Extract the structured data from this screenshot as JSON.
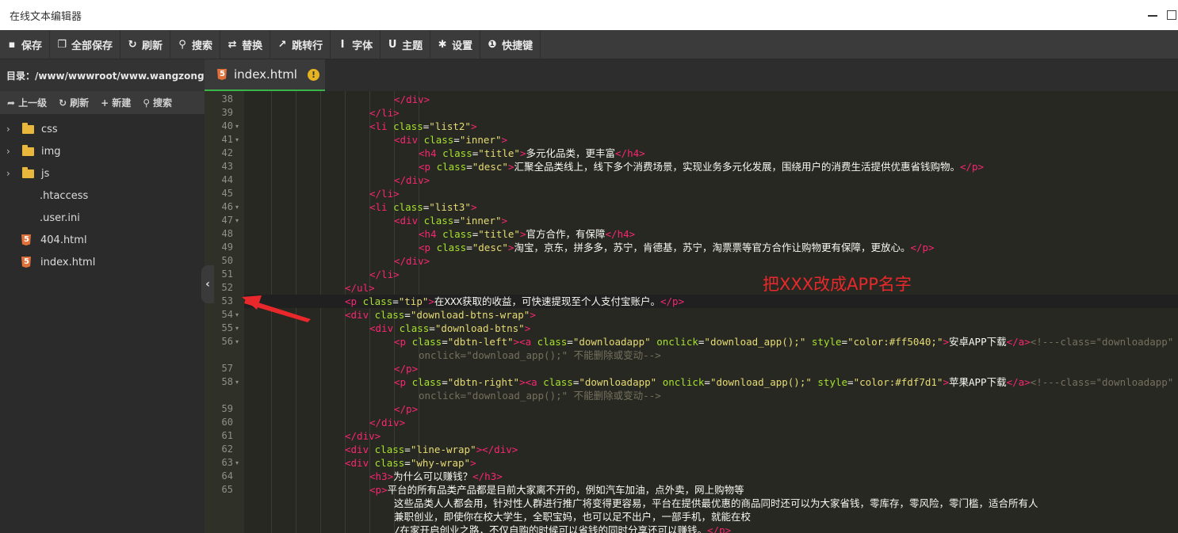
{
  "window": {
    "title": "在线文本编辑器"
  },
  "toolbar": [
    {
      "label": "保存",
      "icon": "save-icon"
    },
    {
      "label": "全部保存",
      "icon": "save-all-icon"
    },
    {
      "label": "刷新",
      "icon": "refresh-icon"
    },
    {
      "label": "搜索",
      "icon": "search-icon"
    },
    {
      "label": "替换",
      "icon": "replace-icon"
    },
    {
      "label": "跳转行",
      "icon": "goto-line-icon"
    },
    {
      "label": "字体",
      "icon": "font-icon"
    },
    {
      "label": "主题",
      "icon": "theme-icon"
    },
    {
      "label": "设置",
      "icon": "gear-icon"
    },
    {
      "label": "快捷键",
      "icon": "info-icon"
    }
  ],
  "sidebar": {
    "directory": "目录：/www/wwwroot/www.wangzong...",
    "tools": [
      {
        "label": "上一级",
        "icon": "share-icon"
      },
      {
        "label": "刷新",
        "icon": "refresh-icon"
      },
      {
        "label": "新建",
        "icon": "plus-icon"
      },
      {
        "label": "搜索",
        "icon": "search-icon"
      }
    ],
    "items": [
      {
        "name": "css",
        "type": "folder"
      },
      {
        "name": "img",
        "type": "folder"
      },
      {
        "name": "js",
        "type": "folder"
      },
      {
        "name": ".htaccess",
        "type": "file"
      },
      {
        "name": ".user.ini",
        "type": "file"
      },
      {
        "name": "404.html",
        "type": "html"
      },
      {
        "name": "index.html",
        "type": "html"
      }
    ]
  },
  "tab": {
    "label": "index.html",
    "modified_mark": "!"
  },
  "annotation": "把XXX改成APP名字",
  "colors": {
    "tag": "#f92672",
    "attr": "#a6e22e",
    "string": "#e6db74",
    "comment": "#75715e",
    "annotation": "#e8282b",
    "active_tab": "#39b54a"
  },
  "editor": {
    "lines": [
      {
        "n": "38",
        "fold": false,
        "indent": 6,
        "parts": [
          [
            "t",
            "</"
          ],
          [
            "t",
            "div"
          ],
          [
            "t",
            ">"
          ]
        ]
      },
      {
        "n": "39",
        "fold": false,
        "indent": 5,
        "parts": [
          [
            "t",
            "</"
          ],
          [
            "t",
            "li"
          ],
          [
            "t",
            ">"
          ]
        ]
      },
      {
        "n": "40",
        "fold": true,
        "indent": 5,
        "parts": [
          [
            "t",
            "<li "
          ],
          [
            "a",
            "class"
          ],
          [
            "p",
            "="
          ],
          [
            "s",
            "\"list2\""
          ],
          [
            "t",
            ">"
          ]
        ]
      },
      {
        "n": "41",
        "fold": true,
        "indent": 6,
        "parts": [
          [
            "t",
            "<div "
          ],
          [
            "a",
            "class"
          ],
          [
            "p",
            "="
          ],
          [
            "s",
            "\"inner\""
          ],
          [
            "t",
            ">"
          ]
        ]
      },
      {
        "n": "42",
        "fold": false,
        "indent": 7,
        "parts": [
          [
            "t",
            "<h4 "
          ],
          [
            "a",
            "class"
          ],
          [
            "p",
            "="
          ],
          [
            "s",
            "\"title\""
          ],
          [
            "t",
            ">"
          ],
          [
            "p",
            "多元化品类，更丰富"
          ],
          [
            "t",
            "</h4>"
          ]
        ]
      },
      {
        "n": "43",
        "fold": false,
        "indent": 7,
        "parts": [
          [
            "t",
            "<p "
          ],
          [
            "a",
            "class"
          ],
          [
            "p",
            "="
          ],
          [
            "s",
            "\"desc\""
          ],
          [
            "t",
            ">"
          ],
          [
            "p",
            "汇聚全品类线上，线下多个消费场景，实现业务多元化发展，围绕用户的消费生活提供优惠省钱购物。"
          ],
          [
            "t",
            "</p>"
          ]
        ]
      },
      {
        "n": "44",
        "fold": false,
        "indent": 6,
        "parts": [
          [
            "t",
            "</div>"
          ]
        ]
      },
      {
        "n": "45",
        "fold": false,
        "indent": 5,
        "parts": [
          [
            "t",
            "</li>"
          ]
        ]
      },
      {
        "n": "46",
        "fold": true,
        "indent": 5,
        "parts": [
          [
            "t",
            "<li "
          ],
          [
            "a",
            "class"
          ],
          [
            "p",
            "="
          ],
          [
            "s",
            "\"list3\""
          ],
          [
            "t",
            ">"
          ]
        ]
      },
      {
        "n": "47",
        "fold": true,
        "indent": 6,
        "parts": [
          [
            "t",
            "<div "
          ],
          [
            "a",
            "class"
          ],
          [
            "p",
            "="
          ],
          [
            "s",
            "\"inner\""
          ],
          [
            "t",
            ">"
          ]
        ]
      },
      {
        "n": "48",
        "fold": false,
        "indent": 7,
        "parts": [
          [
            "t",
            "<h4 "
          ],
          [
            "a",
            "class"
          ],
          [
            "p",
            "="
          ],
          [
            "s",
            "\"title\""
          ],
          [
            "t",
            ">"
          ],
          [
            "p",
            "官方合作，有保障"
          ],
          [
            "t",
            "</h4>"
          ]
        ]
      },
      {
        "n": "49",
        "fold": false,
        "indent": 7,
        "parts": [
          [
            "t",
            "<p "
          ],
          [
            "a",
            "class"
          ],
          [
            "p",
            "="
          ],
          [
            "s",
            "\"desc\""
          ],
          [
            "t",
            ">"
          ],
          [
            "p",
            "淘宝，京东，拼多多，苏宁，肯德基，苏宁，淘票票等官方合作让购物更有保障，更放心。"
          ],
          [
            "t",
            "</p>"
          ]
        ]
      },
      {
        "n": "50",
        "fold": false,
        "indent": 6,
        "parts": [
          [
            "t",
            "</div>"
          ]
        ]
      },
      {
        "n": "51",
        "fold": false,
        "indent": 5,
        "parts": [
          [
            "t",
            "</li>"
          ]
        ]
      },
      {
        "n": "52",
        "fold": false,
        "indent": 4,
        "parts": [
          [
            "t",
            "</ul>"
          ]
        ]
      },
      {
        "n": "53",
        "fold": false,
        "indent": 4,
        "current": true,
        "parts": [
          [
            "t",
            "<p "
          ],
          [
            "a",
            "class"
          ],
          [
            "p",
            "="
          ],
          [
            "s",
            "\"tip\""
          ],
          [
            "t",
            ">"
          ],
          [
            "p",
            "在XXX获取的收益，可快速提现至个人支付宝账户。"
          ],
          [
            "t",
            "</p>"
          ]
        ]
      },
      {
        "n": "54",
        "fold": true,
        "indent": 4,
        "parts": [
          [
            "t",
            "<div "
          ],
          [
            "a",
            "class"
          ],
          [
            "p",
            "="
          ],
          [
            "s",
            "\"download-btns-wrap\""
          ],
          [
            "t",
            ">"
          ]
        ]
      },
      {
        "n": "55",
        "fold": true,
        "indent": 5,
        "parts": [
          [
            "t",
            "<div "
          ],
          [
            "a",
            "class"
          ],
          [
            "p",
            "="
          ],
          [
            "s",
            "\"download-btns\""
          ],
          [
            "t",
            ">"
          ]
        ]
      },
      {
        "n": "56",
        "fold": true,
        "indent": 6,
        "parts": [
          [
            "t",
            "<p "
          ],
          [
            "a",
            "class"
          ],
          [
            "p",
            "="
          ],
          [
            "s",
            "\"dbtn-left\""
          ],
          [
            "t",
            "><a "
          ],
          [
            "a",
            "class"
          ],
          [
            "p",
            "="
          ],
          [
            "s",
            "\"downloadapp\""
          ],
          [
            "p",
            " "
          ],
          [
            "a",
            "onclick"
          ],
          [
            "p",
            "="
          ],
          [
            "s",
            "\"download_app();\""
          ],
          [
            "p",
            " "
          ],
          [
            "a",
            "style"
          ],
          [
            "p",
            "="
          ],
          [
            "s",
            "\"color:#ff5040;\""
          ],
          [
            "t",
            ">"
          ],
          [
            "p",
            "安卓APP下载"
          ],
          [
            "t",
            "</a>"
          ],
          [
            "c",
            "<!---class=\"downloadapp\""
          ]
        ]
      },
      {
        "n": "",
        "fold": false,
        "indent": 7,
        "parts": [
          [
            "c",
            "onclick=\"download_app();\" 不能删除或变动-->"
          ]
        ]
      },
      {
        "n": "57",
        "fold": false,
        "indent": 6,
        "parts": [
          [
            "t",
            "</p>"
          ]
        ]
      },
      {
        "n": "58",
        "fold": true,
        "indent": 6,
        "parts": [
          [
            "t",
            "<p "
          ],
          [
            "a",
            "class"
          ],
          [
            "p",
            "="
          ],
          [
            "s",
            "\"dbtn-right\""
          ],
          [
            "t",
            "><a "
          ],
          [
            "a",
            "class"
          ],
          [
            "p",
            "="
          ],
          [
            "s",
            "\"downloadapp\""
          ],
          [
            "p",
            " "
          ],
          [
            "a",
            "onclick"
          ],
          [
            "p",
            "="
          ],
          [
            "s",
            "\"download_app();\""
          ],
          [
            "p",
            " "
          ],
          [
            "a",
            "style"
          ],
          [
            "p",
            "="
          ],
          [
            "s",
            "\"color:#fdf7d1\""
          ],
          [
            "t",
            ">"
          ],
          [
            "p",
            "苹果APP下载"
          ],
          [
            "t",
            "</a>"
          ],
          [
            "c",
            "<!---class=\"downloadapp\""
          ]
        ]
      },
      {
        "n": "",
        "fold": false,
        "indent": 7,
        "parts": [
          [
            "c",
            "onclick=\"download_app();\" 不能删除或变动-->"
          ]
        ]
      },
      {
        "n": "59",
        "fold": false,
        "indent": 6,
        "parts": [
          [
            "t",
            "</p>"
          ]
        ]
      },
      {
        "n": "60",
        "fold": false,
        "indent": 5,
        "parts": [
          [
            "t",
            "</div>"
          ]
        ]
      },
      {
        "n": "61",
        "fold": false,
        "indent": 4,
        "parts": [
          [
            "t",
            "</div>"
          ]
        ]
      },
      {
        "n": "62",
        "fold": false,
        "indent": 4,
        "parts": [
          [
            "t",
            "<div "
          ],
          [
            "a",
            "class"
          ],
          [
            "p",
            "="
          ],
          [
            "s",
            "\"line-wrap\""
          ],
          [
            "t",
            "></div>"
          ]
        ]
      },
      {
        "n": "63",
        "fold": true,
        "indent": 4,
        "parts": [
          [
            "t",
            "<div "
          ],
          [
            "a",
            "class"
          ],
          [
            "p",
            "="
          ],
          [
            "s",
            "\"why-wrap\""
          ],
          [
            "t",
            ">"
          ]
        ]
      },
      {
        "n": "64",
        "fold": false,
        "indent": 5,
        "parts": [
          [
            "t",
            "<h3>"
          ],
          [
            "p",
            "为什么可以赚钱？"
          ],
          [
            "t",
            "</h3>"
          ]
        ]
      },
      {
        "n": "65",
        "fold": false,
        "indent": 5,
        "parts": [
          [
            "t",
            "<p>"
          ],
          [
            "p",
            "平台的所有品类产品都是目前大家离不开的，例如汽车加油，点外卖，网上购物等"
          ]
        ]
      },
      {
        "n": "",
        "fold": false,
        "indent": 6,
        "parts": [
          [
            "p",
            "这些品类人人都会用，针对性人群进行推广将变得更容易，平台在提供最优惠的商品同时还可以为大家省钱，零库存，零风险，零门槛，适合所有人"
          ]
        ]
      },
      {
        "n": "",
        "fold": false,
        "indent": 6,
        "parts": [
          [
            "p",
            "兼职创业，即使你在校大学生，全职宝妈，也可以足不出户，一部手机，就能在校"
          ]
        ]
      },
      {
        "n": "",
        "fold": false,
        "indent": 6,
        "parts": [
          [
            "p",
            "/在家开启创业之路，不仅自购的时候可以省钱的同时分享还可以赚钱。"
          ],
          [
            "t",
            "</p>"
          ]
        ]
      }
    ]
  }
}
